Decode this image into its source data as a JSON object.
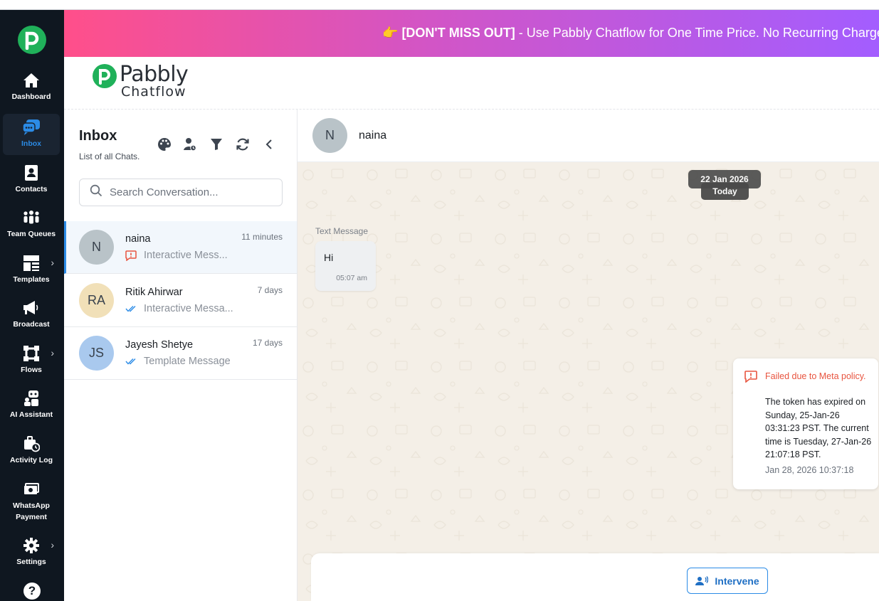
{
  "sidebar": {
    "items": [
      {
        "label": "Dashboard",
        "icon": "home-icon"
      },
      {
        "label": "Inbox",
        "icon": "chat-bubbles-icon"
      },
      {
        "label": "Contacts",
        "icon": "contact-card-icon"
      },
      {
        "label": "Team Queues",
        "icon": "team-icon"
      },
      {
        "label": "Templates",
        "icon": "template-icon"
      },
      {
        "label": "Broadcast",
        "icon": "megaphone-icon"
      },
      {
        "label": "Flows",
        "icon": "flow-icon"
      },
      {
        "label": "AI Assistant",
        "icon": "robot-icon"
      },
      {
        "label": "Activity Log",
        "icon": "briefcase-clock-icon"
      },
      {
        "label": "WhatsApp Payment",
        "icon": "money-icon"
      },
      {
        "label": "Settings",
        "icon": "gear-icon"
      }
    ],
    "help_glyph": "?"
  },
  "banner": {
    "emoji": "👉",
    "bold": "[DON'T MISS OUT]",
    "text": " - Use Pabbly Chatflow for One Time Price. No Recurring Charges"
  },
  "brand": {
    "name": "Pabbly",
    "product": "Chatflow"
  },
  "inbox": {
    "title": "Inbox",
    "subtitle": "List of all Chats.",
    "search_placeholder": "Search Conversation...",
    "chats": [
      {
        "initials": "N",
        "name": "naina",
        "time": "11 minutes",
        "preview": "Interactive Mess...",
        "status": "failed",
        "avatar_color": "#b9c3c8"
      },
      {
        "initials": "RA",
        "name": "Ritik Ahirwar",
        "time": "7 days",
        "preview": "Interactive Messa...",
        "status": "read",
        "avatar_color": "#f1e0b8"
      },
      {
        "initials": "JS",
        "name": "Jayesh Shetye",
        "time": "17 days",
        "preview": "Template Message",
        "status": "read",
        "avatar_color": "#a9c9ee"
      }
    ]
  },
  "conversation": {
    "contact_initial": "N",
    "contact_name": "naina",
    "date_label": "22 Jan 2026",
    "today_label": "Today",
    "incoming": {
      "type_label": "Text Message",
      "text": "Hi",
      "time": "05:07 am"
    },
    "failed": {
      "title": "Failed due to Meta policy.",
      "detail": "The token has expired on Sunday, 25-Jan-26 03:31:23 PST. The current time is Tuesday, 27-Jan-26 21:07:18 PST.",
      "timestamp": "Jan 28, 2026 10:37:18"
    },
    "intervene_label": "Intervene"
  },
  "colors": {
    "accent": "#2b8be6",
    "brand_green": "#20b15a",
    "error": "#e8543f",
    "sidebar_bg": "#0f1720"
  }
}
